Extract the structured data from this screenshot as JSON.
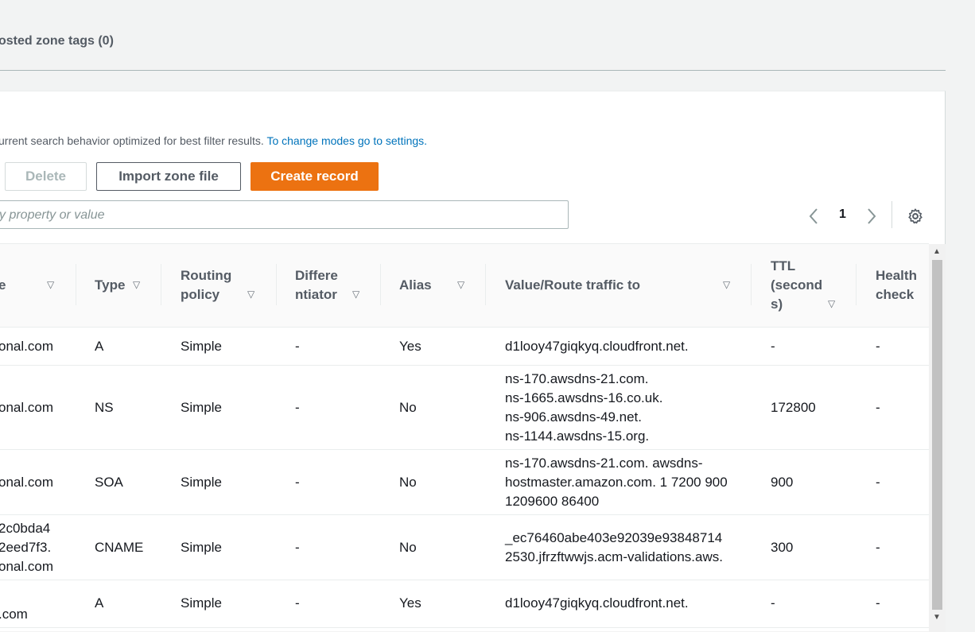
{
  "tabs": {
    "tags_label": "osted zone tags (0)"
  },
  "records": {
    "note_text": "urrent search behavior optimized for best filter results.",
    "note_link": "To change modes go to settings.",
    "buttons": {
      "delete": "Delete",
      "import": "Import zone file",
      "create": "Create record"
    },
    "search_placeholder": "y property or value",
    "pagination": {
      "page": "1",
      "prev_icon": "chevron-left",
      "next_icon": "chevron-right",
      "settings_icon": "gear"
    },
    "columns": {
      "name": "e",
      "type": "Type",
      "routing_line1": "Routing",
      "routing_line2": "policy",
      "diff_line1": "Differe",
      "diff_line2": "ntiator",
      "alias": "Alias",
      "value": "Value/Route traffic to",
      "ttl_line1": "TTL",
      "ttl_line2": "(second",
      "ttl_line3": "s)",
      "health_line1": "Health",
      "health_line2": "check"
    },
    "rows": [
      {
        "name": [
          "onal.com"
        ],
        "type": "A",
        "routing": "Simple",
        "diff": "-",
        "alias": "Yes",
        "value": [
          "d1looy47giqkyq.cloudfront.net."
        ],
        "ttl": "-",
        "health": "-"
      },
      {
        "name": [
          "onal.com"
        ],
        "type": "NS",
        "routing": "Simple",
        "diff": "-",
        "alias": "No",
        "value": [
          "ns-170.awsdns-21.com.",
          "ns-1665.awsdns-16.co.uk.",
          "ns-906.awsdns-49.net.",
          "ns-1144.awsdns-15.org."
        ],
        "ttl": "172800",
        "health": "-"
      },
      {
        "name": [
          "onal.com"
        ],
        "type": "SOA",
        "routing": "Simple",
        "diff": "-",
        "alias": "No",
        "value": [
          "ns-170.awsdns-21.com. awsdns-",
          "hostmaster.amazon.com. 1 7200 900",
          "1209600 86400"
        ],
        "ttl": "900",
        "health": "-"
      },
      {
        "name": [
          "2c0bda4",
          "2eed7f3.",
          "onal.com"
        ],
        "type": "CNAME",
        "routing": "Simple",
        "diff": "-",
        "alias": "No",
        "value": [
          "_ec76460abe403e92039e93848714",
          "2530.jfrzftwwjs.acm-validations.aws."
        ],
        "ttl": "300",
        "health": "-"
      },
      {
        "name": [
          ".com"
        ],
        "type": "A",
        "routing": "Simple",
        "diff": "-",
        "alias": "Yes",
        "value": [
          "d1looy47giqkyq.cloudfront.net."
        ],
        "ttl": "-",
        "health": "-"
      }
    ]
  }
}
